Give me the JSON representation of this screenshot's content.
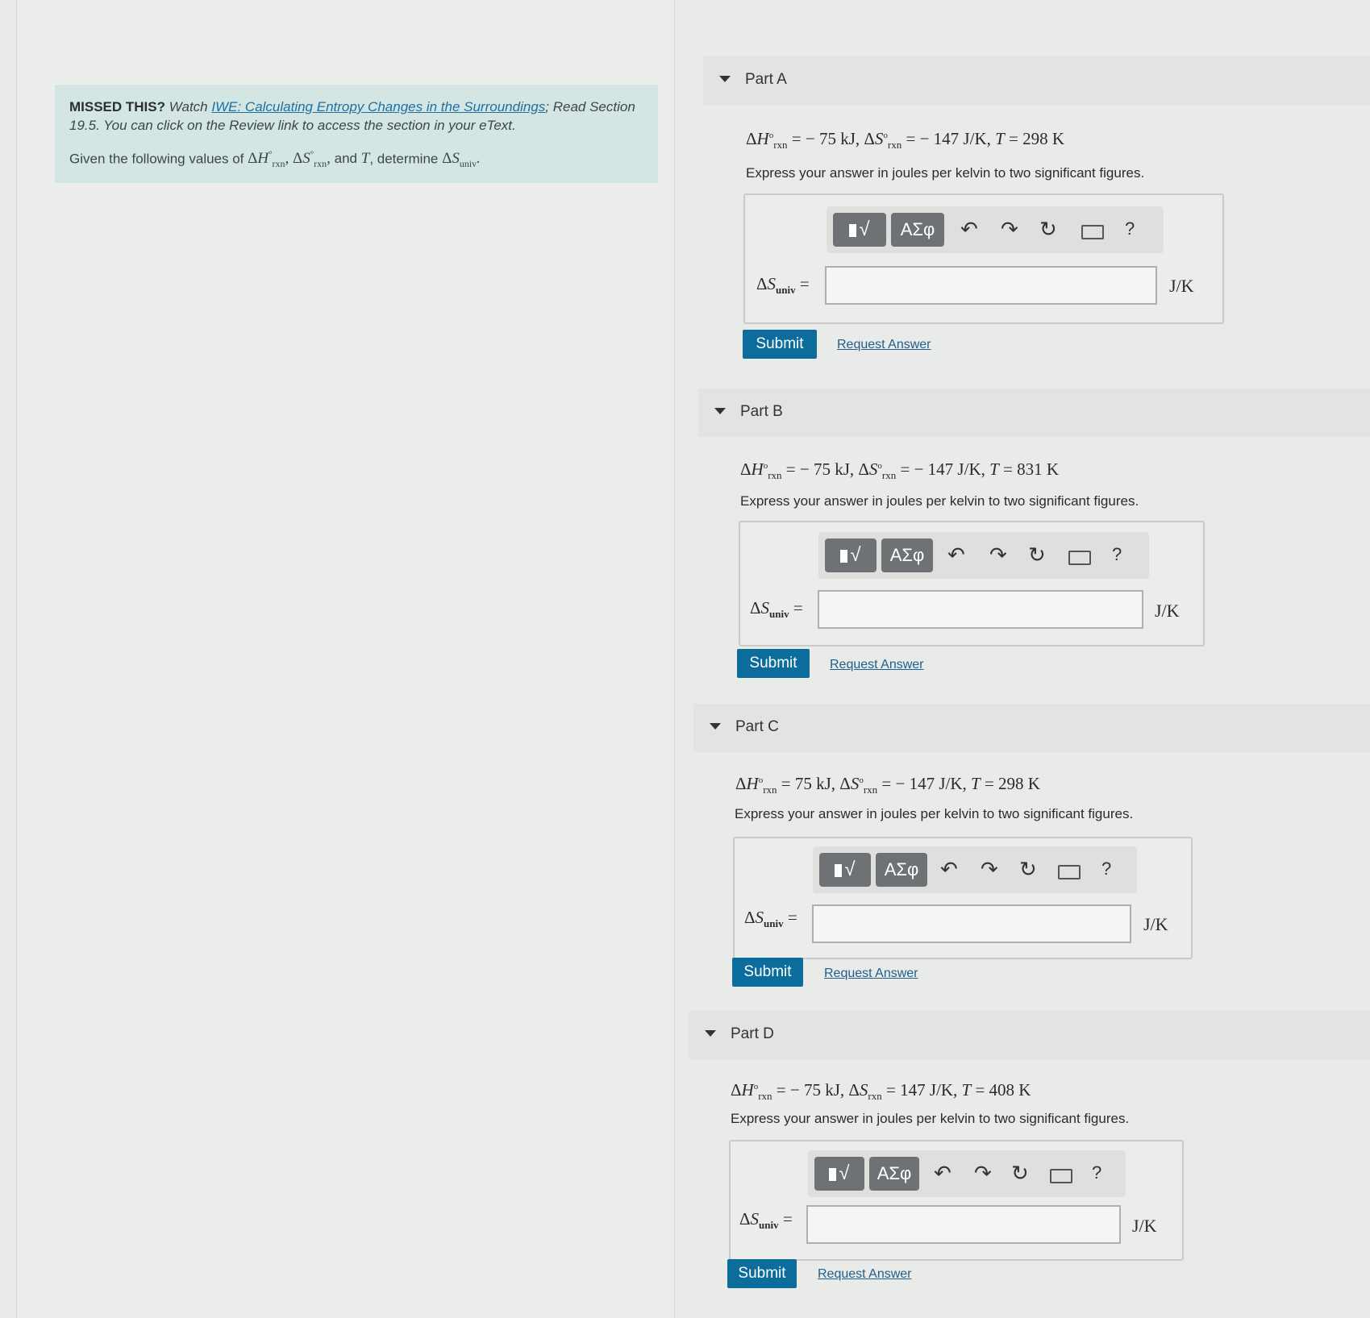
{
  "missed": {
    "label": "MISSED THIS?",
    "watch": "Watch",
    "link": "IWE: Calculating Entropy Changes in the Surroundings",
    "read": "; Read Section 19.5. You can click on the Review link to access the section in your eText.",
    "given_prefix": "Given the following values of",
    "given_suffix": ", determine"
  },
  "toolbar": {
    "templates_label": "√",
    "symbols_label": "ΑΣφ",
    "undo": "↶",
    "redo": "↷",
    "reset": "↻",
    "help": "?"
  },
  "parts": [
    {
      "title": "Part A",
      "equation": "ΔH°rxn = − 75 kJ, ΔS°rxn = − 147 J/K, T = 298 K",
      "instruction": "Express your answer in joules per kelvin to two significant figures.",
      "label": "ΔSuniv =",
      "unit": "J/K",
      "submit": "Submit",
      "request": "Request Answer"
    },
    {
      "title": "Part B",
      "equation": "ΔH°rxn = − 75 kJ, ΔS°rxn = − 147 J/K, T = 831 K",
      "instruction": "Express your answer in joules per kelvin to two significant figures.",
      "label": "ΔSuniv =",
      "unit": "J/K",
      "submit": "Submit",
      "request": "Request Answer"
    },
    {
      "title": "Part C",
      "equation": "ΔH°rxn = 75 kJ, ΔS°rxn = − 147 J/K, T = 298 K",
      "instruction": "Express your answer in joules per kelvin to two significant figures.",
      "label": "ΔSuniv =",
      "unit": "J/K",
      "submit": "Submit",
      "request": "Request Answer"
    },
    {
      "title": "Part D",
      "equation": "ΔH°rxn = − 75 kJ, ΔSrxn = 147 J/K, T = 408 K",
      "instruction": "Express your answer in joules per kelvin to two significant figures.",
      "label": "ΔSuniv =",
      "unit": "J/K",
      "submit": "Submit",
      "request": "Request Answer"
    }
  ]
}
